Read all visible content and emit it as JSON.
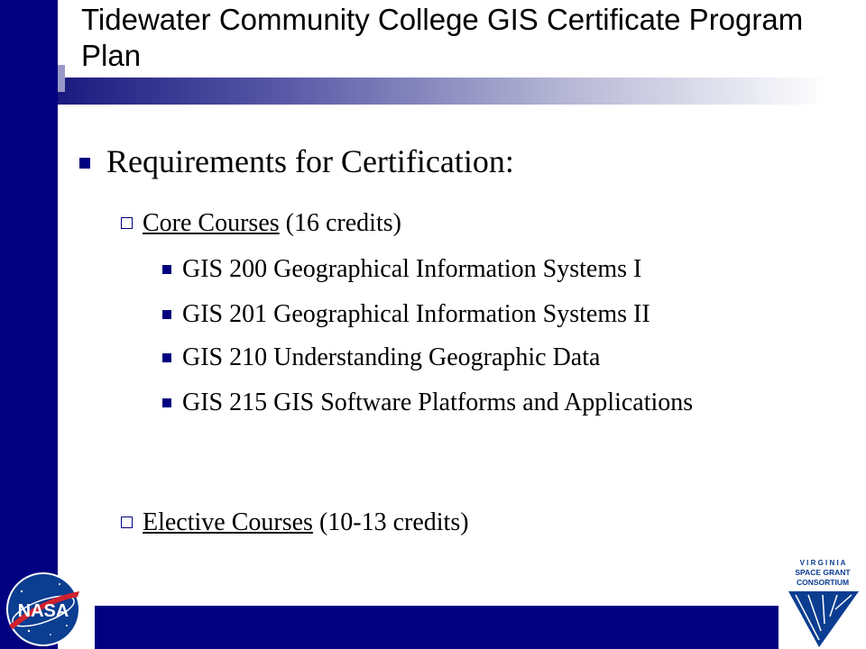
{
  "slide": {
    "title": "Tidewater Community College GIS Certificate Program Plan",
    "heading": "Requirements for Certification:",
    "sections": [
      {
        "label": "Core Courses",
        "detail": "(16 credits)",
        "items": [
          "GIS 200 Geographical Information Systems I",
          "GIS 201 Geographical Information Systems II",
          "GIS 210 Understanding Geographic Data",
          "GIS 215 GIS Software Platforms and Applications"
        ]
      },
      {
        "label": "Elective Courses",
        "detail": "(10-13 credits)",
        "items": []
      }
    ]
  },
  "logos": {
    "nasa": "NASA",
    "vsgc_line1": "V I R G I N I A",
    "vsgc_line2": "SPACE GRANT",
    "vsgc_line3": "CONSORTIUM"
  },
  "colors": {
    "accent": "#000080"
  }
}
